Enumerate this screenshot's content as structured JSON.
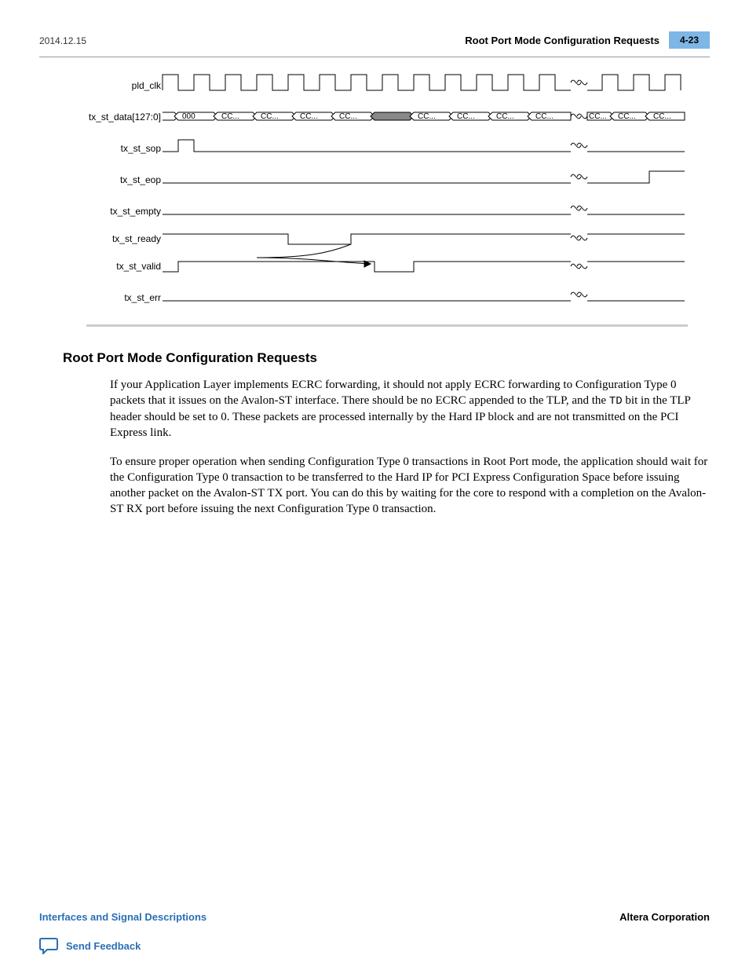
{
  "header": {
    "date": "2014.12.15",
    "title": "Root Port Mode Configuration Requests",
    "page_number": "4-23"
  },
  "diagram": {
    "signals": [
      "pld_clk",
      "tx_st_data[127:0]",
      "tx_st_sop",
      "tx_st_eop",
      "tx_st_empty",
      "tx_st_ready",
      "tx_st_valid",
      "tx_st_err"
    ],
    "data_values": [
      "000",
      "CC...",
      "CC...",
      "CC...",
      "CC...",
      "CC...",
      "CC...",
      "CC...",
      "CC...",
      "CC...",
      "CC...",
      "CC..."
    ]
  },
  "section": {
    "heading": "Root Port Mode Configuration Requests",
    "para1_a": "If your Application Layer implements ECRC forwarding, it should not apply ECRC forwarding to Configuration Type 0 packets that it issues on the Avalon-ST interface. There should be no ECRC appended to the TLP, and the ",
    "para1_td": "TD",
    "para1_b": " bit in the TLP header should be set to 0. These packets are processed internally by the Hard IP block and are not transmitted on the PCI Express link.",
    "para2": "To ensure proper operation when sending Configuration Type 0 transactions in Root Port mode, the application should wait for the Configuration Type 0 transaction to be transferred to the Hard IP for PCI Express Configuration Space before issuing another packet on the Avalon-ST TX port. You can do this by waiting for the core to respond with a completion on the Avalon-ST RX port before issuing the next Configuration Type 0 transaction."
  },
  "footer": {
    "left": "Interfaces and Signal Descriptions",
    "right": "Altera Corporation",
    "feedback": "Send Feedback"
  }
}
